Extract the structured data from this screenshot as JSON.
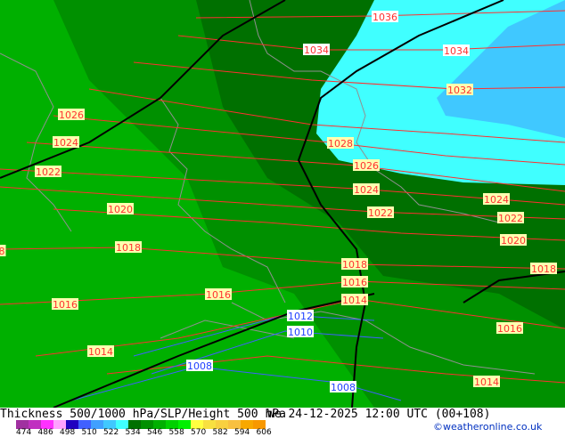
{
  "title": "Thickness 500/1000 hPa/SLP/Height 500 hPa",
  "datetime": "We 24-12-2025 12:00 UTC (00+108)",
  "credit": "©weatheronline.co.uk",
  "colorbar": {
    "ticks": [
      "474",
      "486",
      "498",
      "510",
      "522",
      "534",
      "546",
      "558",
      "570",
      "582",
      "594",
      "606"
    ],
    "colors": [
      "#a030a0",
      "#c030c0",
      "#ff30ff",
      "#ffa0ff",
      "#2000c0",
      "#4060ff",
      "#40a0ff",
      "#40c8ff",
      "#40ffff",
      "#007000",
      "#009000",
      "#00b000",
      "#00d000",
      "#00f000",
      "#ffff40",
      "#f8e040",
      "#f8d040",
      "#f8c040",
      "#f8a800",
      "#f89800"
    ]
  },
  "map_colors": {
    "green": "#00b000",
    "mid_green": "#009000",
    "dark_green": "#007000",
    "cyan": "#40ffff",
    "light_blue": "#40c8ff",
    "isobar": "#ff3030",
    "isobar_low": "#4060ff",
    "height_line": "#000000"
  },
  "isobar_labels": [
    {
      "text": "1036",
      "bg": "#ffffff"
    },
    {
      "text": "1034",
      "bg": "#ffffff"
    },
    {
      "text": "1034",
      "bg": "#ffffff"
    },
    {
      "text": "1032",
      "bg": "#ffffb0"
    },
    {
      "text": "1028",
      "bg": "#ffffb0"
    },
    {
      "text": "1026",
      "bg": "#ffffb0"
    },
    {
      "text": "1026",
      "bg": "#ffffb0"
    },
    {
      "text": "1024",
      "bg": "#ffffb0"
    },
    {
      "text": "1024",
      "bg": "#ffffb0"
    },
    {
      "text": "1024",
      "bg": "#ffffb0"
    },
    {
      "text": "1022",
      "bg": "#ffffb0"
    },
    {
      "text": "1022",
      "bg": "#ffffb0"
    },
    {
      "text": "1022",
      "bg": "#ffffb0"
    },
    {
      "text": "1020",
      "bg": "#ffffb0"
    },
    {
      "text": "1020",
      "bg": "#ffffb0"
    },
    {
      "text": "1018",
      "bg": "#ffffb0"
    },
    {
      "text": "1018",
      "bg": "#ffffb0"
    },
    {
      "text": "1018",
      "bg": "#ffffb0"
    },
    {
      "text": "1016",
      "bg": "#ffffb0"
    },
    {
      "text": "1016",
      "bg": "#ffffb0"
    },
    {
      "text": "1016",
      "bg": "#ffffb0"
    },
    {
      "text": "1016",
      "bg": "#ffffb0"
    },
    {
      "text": "1014",
      "bg": "#ffffb0"
    },
    {
      "text": "1014",
      "bg": "#ffffb0"
    },
    {
      "text": "1014",
      "bg": "#ffffb0"
    },
    {
      "text": "1012",
      "bg": "#ffffff"
    },
    {
      "text": "1010",
      "bg": "#ffffff"
    },
    {
      "text": "1008",
      "bg": "#ffffff"
    },
    {
      "text": "1008",
      "bg": "#ffffff"
    },
    {
      "text": "8",
      "bg": "#ffffb0"
    }
  ]
}
